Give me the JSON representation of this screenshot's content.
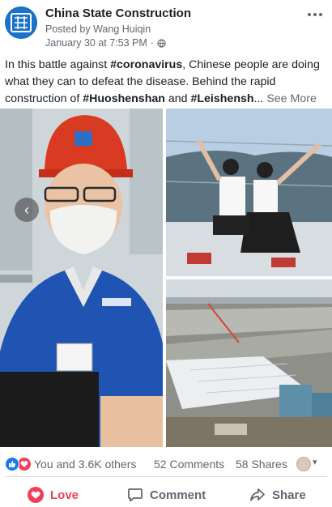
{
  "post": {
    "page_name": "China State Construction",
    "posted_by": "Posted by Wang Huiqin",
    "timestamp": "January 30 at 7:53 PM",
    "meta_separator": "·",
    "privacy_icon": "globe-icon",
    "more_icon": "more-dots-icon",
    "text": {
      "part1": "In this battle against ",
      "tag1": "#coronavirus",
      "part2": ", Chinese people are doing what they can to defeat the disease. Behind the rapid construction of ",
      "tag2": "#Huoshenshan",
      "part3": " and ",
      "tag3": "#Leishensh",
      "ellipsis": "...",
      "see_more": "See More"
    }
  },
  "photos": {
    "items": [
      {
        "name": "worker-in-helmet-photo"
      },
      {
        "name": "couple-on-glass-floor-photo"
      },
      {
        "name": "hospital-construction-site-photo"
      }
    ],
    "prev_arrow": "‹"
  },
  "reactions": {
    "icons": [
      "like-icon",
      "love-icon"
    ],
    "summary": "You and 3.6K others",
    "comments": "52 Comments",
    "shares": "58 Shares"
  },
  "actions": {
    "love_label": "Love",
    "comment_label": "Comment",
    "share_label": "Share"
  },
  "colors": {
    "brand_blue": "#1a73c8",
    "like_blue": "#1877f2",
    "love_red": "#f33e58",
    "secondary_text": "#606770"
  }
}
